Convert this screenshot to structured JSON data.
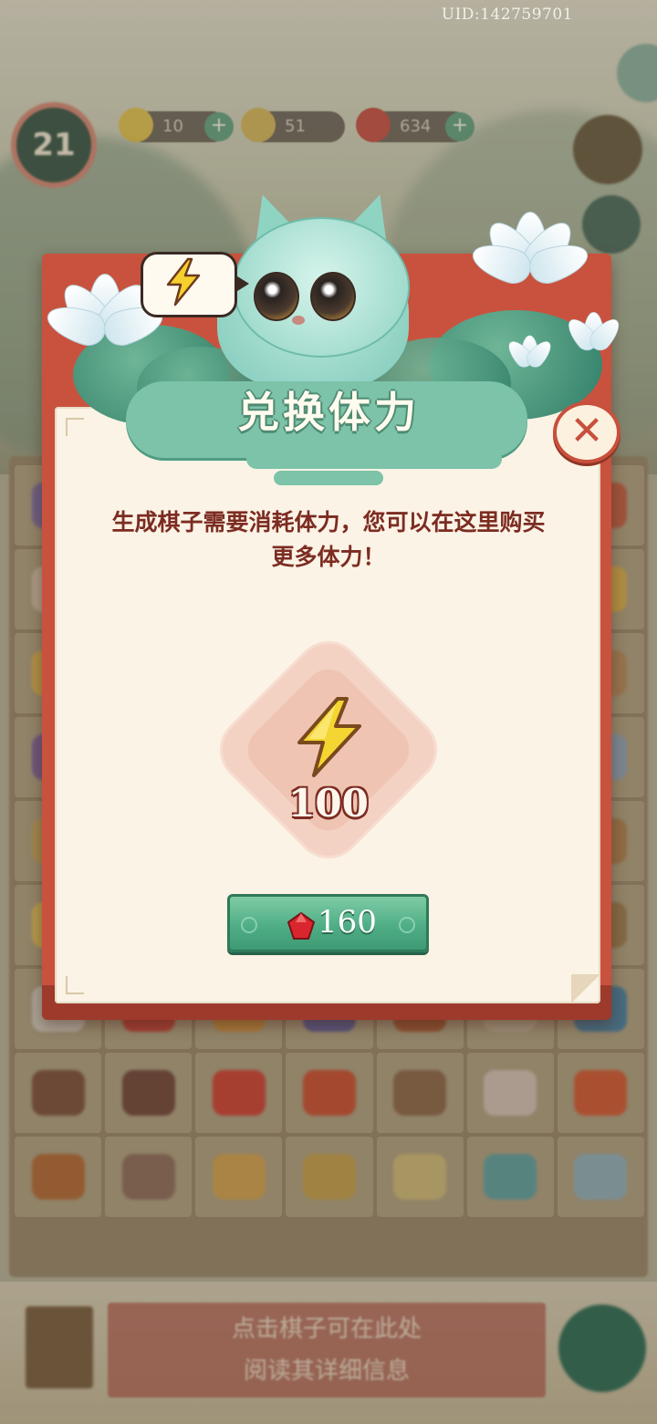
{
  "header": {
    "uid": "UID:142759701"
  },
  "hud": {
    "level": "21",
    "energy": "10",
    "coins": "51",
    "gems": "634"
  },
  "background": {
    "hint_line1": "点击棋子可在此处",
    "hint_line2": "阅读其详细信息"
  },
  "dialog": {
    "title": "兑换体力",
    "description_line1": "生成棋子需要消耗体力，您可以在这里购买",
    "description_line2": "更多体力！",
    "reward": {
      "icon": "lightning-bolt-icon",
      "amount": "100"
    },
    "buy_button": {
      "icon": "red-gem-icon",
      "price": "160"
    },
    "close_icon": "close-x-icon"
  },
  "colors": {
    "frame": "#c9523e",
    "paper": "#fbf3e5",
    "text": "#7c2c22",
    "button": "#4fae86",
    "title_cloud": "#7cc3a9"
  }
}
